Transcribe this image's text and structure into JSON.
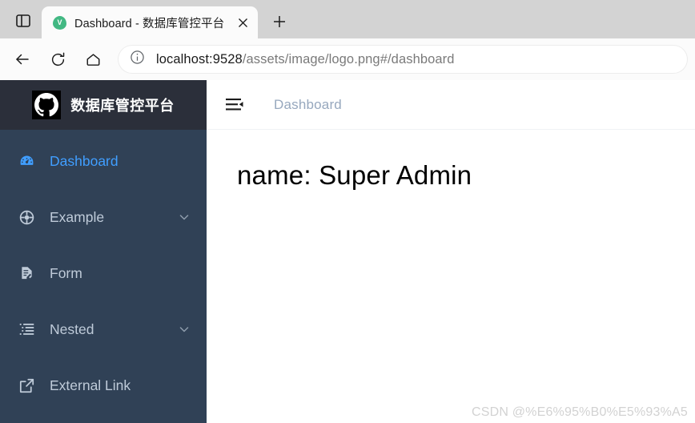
{
  "browser": {
    "tab_list_icon": "tab-list-icon",
    "tab": {
      "favicon_letter": "V",
      "favicon_name": "vue-favicon",
      "title": "Dashboard - 数据库管控平台",
      "close_label": "×"
    },
    "new_tab_label": "+",
    "nav": {
      "back_icon": "back-arrow-icon",
      "reload_icon": "reload-icon",
      "home_icon": "home-icon"
    },
    "address_bar": {
      "info_icon": "site-info-icon",
      "host": "localhost:9528",
      "path": "/assets/image/logo.png#/dashboard",
      "full_url": "localhost:9528/assets/image/logo.png#/dashboard"
    }
  },
  "sidebar": {
    "logo": {
      "icon_name": "github-logo-icon",
      "title": "数据库管控平台"
    },
    "items": [
      {
        "label": "Dashboard",
        "icon": "dashboard-gauge-icon",
        "active": true,
        "expandable": false
      },
      {
        "label": "Example",
        "icon": "component-lifebuoy-icon",
        "active": false,
        "expandable": true
      },
      {
        "label": "Form",
        "icon": "form-document-icon",
        "active": false,
        "expandable": false
      },
      {
        "label": "Nested",
        "icon": "nested-list-icon",
        "active": false,
        "expandable": true
      },
      {
        "label": "External Link",
        "icon": "external-link-icon",
        "active": false,
        "expandable": false
      }
    ]
  },
  "navbar": {
    "hamburger_icon": "hamburger-collapse-icon",
    "breadcrumb": "Dashboard"
  },
  "main": {
    "dashboard_text": "name: Super Admin",
    "watermark": "CSDN @%E6%95%B0%E5%93%A5"
  },
  "colors": {
    "sidebar_bg": "#304156",
    "logo_bg": "#2b2f3a",
    "menu_text": "#bfcbd9",
    "menu_active": "#409eff",
    "breadcrumb_text": "#97a8be",
    "tabstrip_bg": "#d3d3d3",
    "favicon_green": "#42b883"
  }
}
